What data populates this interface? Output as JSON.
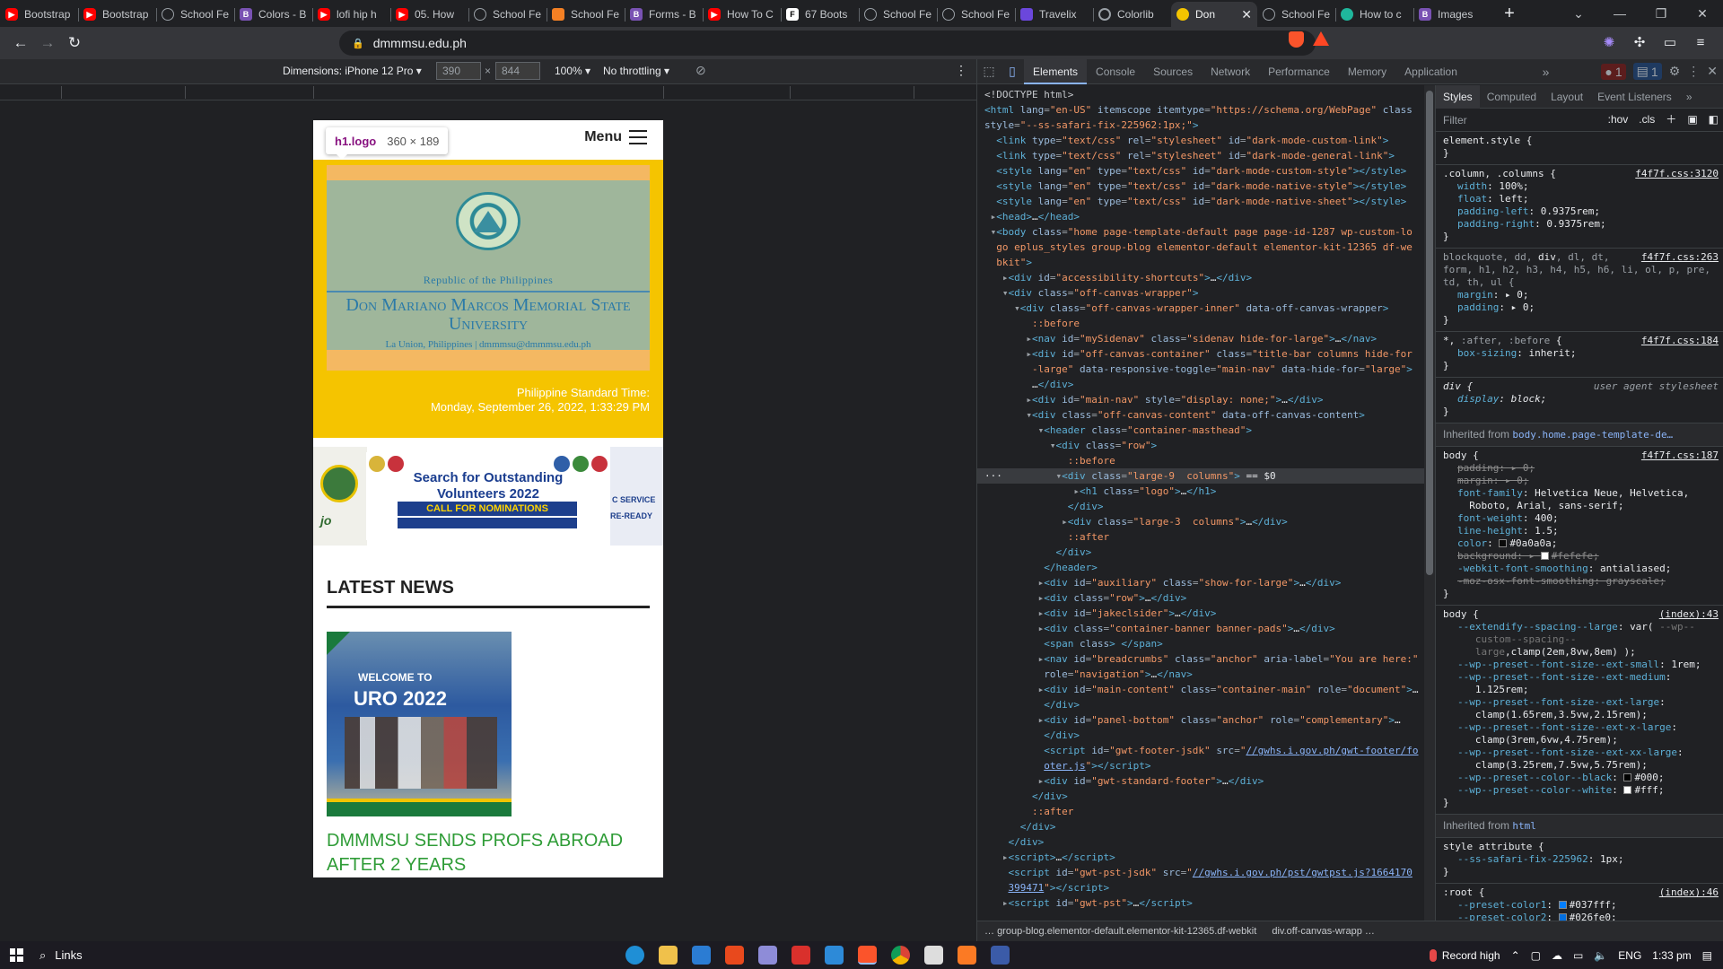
{
  "tabs": [
    {
      "label": "Bootstrap",
      "icon": "youtube-icon",
      "kind": "yt"
    },
    {
      "label": "Bootstrap",
      "icon": "youtube-icon",
      "kind": "yt"
    },
    {
      "label": "School Fe",
      "icon": "globe-icon",
      "kind": "globe"
    },
    {
      "label": "Colors - B",
      "icon": "bootstrap-icon",
      "kind": "bs"
    },
    {
      "label": "lofi hip h",
      "icon": "youtube-icon",
      "kind": "yt"
    },
    {
      "label": "05. How",
      "icon": "youtube-icon",
      "kind": "yt"
    },
    {
      "label": "School Fe",
      "icon": "globe-icon",
      "kind": "globe"
    },
    {
      "label": "School Fe",
      "icon": "stackoverflow-icon",
      "kind": "so"
    },
    {
      "label": "Forms - B",
      "icon": "bootstrap-icon",
      "kind": "bs"
    },
    {
      "label": "How To C",
      "icon": "youtube-icon",
      "kind": "yt"
    },
    {
      "label": "67 Boots",
      "icon": "f-icon",
      "kind": "f"
    },
    {
      "label": "School Fe",
      "icon": "globe-icon",
      "kind": "globe"
    },
    {
      "label": "School Fe",
      "icon": "globe-icon",
      "kind": "globe"
    },
    {
      "label": "Travelix",
      "icon": "travelix-icon",
      "kind": "tr"
    },
    {
      "label": "Colorlib",
      "icon": "colorlib-icon",
      "kind": "cl"
    },
    {
      "label": "Don",
      "icon": "dmmmsu-icon",
      "kind": "dm",
      "active": true
    },
    {
      "label": "School Fe",
      "icon": "globe-icon",
      "kind": "globe"
    },
    {
      "label": "How to c",
      "icon": "grammarly-icon",
      "kind": "gr"
    },
    {
      "label": "Images",
      "icon": "bootstrap-icon",
      "kind": "bs"
    }
  ],
  "toolbar": {
    "url": "dmmmsu.edu.ph"
  },
  "device_toolbar": {
    "dimensions_label": "Dimensions: iPhone 12 Pro",
    "width": "390",
    "height": "844",
    "times": "×",
    "zoom": "100%",
    "throttling": "No throttling"
  },
  "page": {
    "menu_label": "Menu",
    "tooltip_name": "h1.logo",
    "tooltip_size": "360 × 189",
    "logo": {
      "republic": "Republic of the Philippines",
      "university": "Don Mariano Marcos Memorial State University",
      "location": "La Union, Philippines | dmmmsu@dmmmsu.edu.ph"
    },
    "time_label": "Philippine Standard Time:",
    "time_value": "Monday, September 26, 2022, 1:33:29 PM",
    "banner": {
      "title": "Search for Outstanding Volunteers 2022",
      "cta": "CALL FOR NOMINATIONS",
      "left_text": "jo",
      "right_text_1": "C SERVICE",
      "right_text_2": "RE-READY"
    },
    "news_heading": "LATEST NEWS",
    "news_image_text_1": "WELCOME TO",
    "news_image_text_2": "URO 2022",
    "news_title": "DMMMSU SENDS PROFS ABROAD AFTER 2 YEARS"
  },
  "devtools": {
    "tabs": [
      "Elements",
      "Console",
      "Sources",
      "Network",
      "Performance",
      "Memory",
      "Application"
    ],
    "active_tab": "Elements",
    "error_count": "1",
    "message_count": "1",
    "styles_tabs": [
      "Styles",
      "Computed",
      "Layout",
      "Event Listeners"
    ],
    "filter_placeholder": "Filter",
    "hov": ":hov",
    "cls": ".cls",
    "breadcrumb_1": "group-blog.elementor-default.elementor-kit-12365.df-webkit",
    "breadcrumb_2": "div.off-canvas-wrapp",
    "inherited_body": "body.home.page-template-de…",
    "inherited_html": "html"
  },
  "taskbar": {
    "search_label": "Links",
    "record_label": "Record high",
    "language": "ENG",
    "clock": "1:33 pm"
  },
  "colors": {
    "masthead_yellow": "#f5c400",
    "news_green": "#2f9c37",
    "devtools_bg": "#202124"
  }
}
